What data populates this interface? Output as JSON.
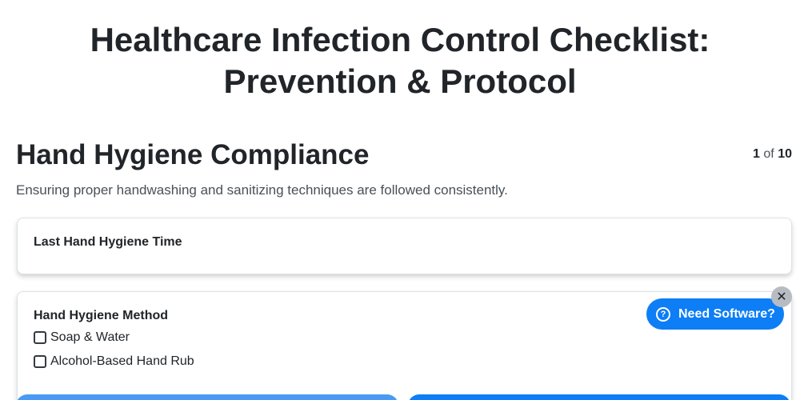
{
  "page": {
    "title": "Healthcare Infection Control Checklist: Prevention & Protocol"
  },
  "section": {
    "title": "Hand Hygiene Compliance",
    "description": "Ensuring proper handwashing and sanitizing techniques are followed consistently.",
    "pager": {
      "current": "1",
      "separator": "of",
      "total": "10"
    }
  },
  "fields": {
    "last_time": {
      "label": "Last Hand Hygiene Time"
    },
    "method": {
      "label": "Hand Hygiene Method",
      "options": [
        {
          "label": "Soap & Water",
          "checked": false
        },
        {
          "label": "Alcohol-Based Hand Rub",
          "checked": false
        }
      ]
    }
  },
  "promo": {
    "button_label": "Need Software?",
    "icon": "question-circle-icon",
    "close_icon": "close-icon"
  },
  "colors": {
    "accent": "#0d7ef5",
    "accent_light": "#4a9af3",
    "text": "#212529",
    "muted": "#495057"
  }
}
